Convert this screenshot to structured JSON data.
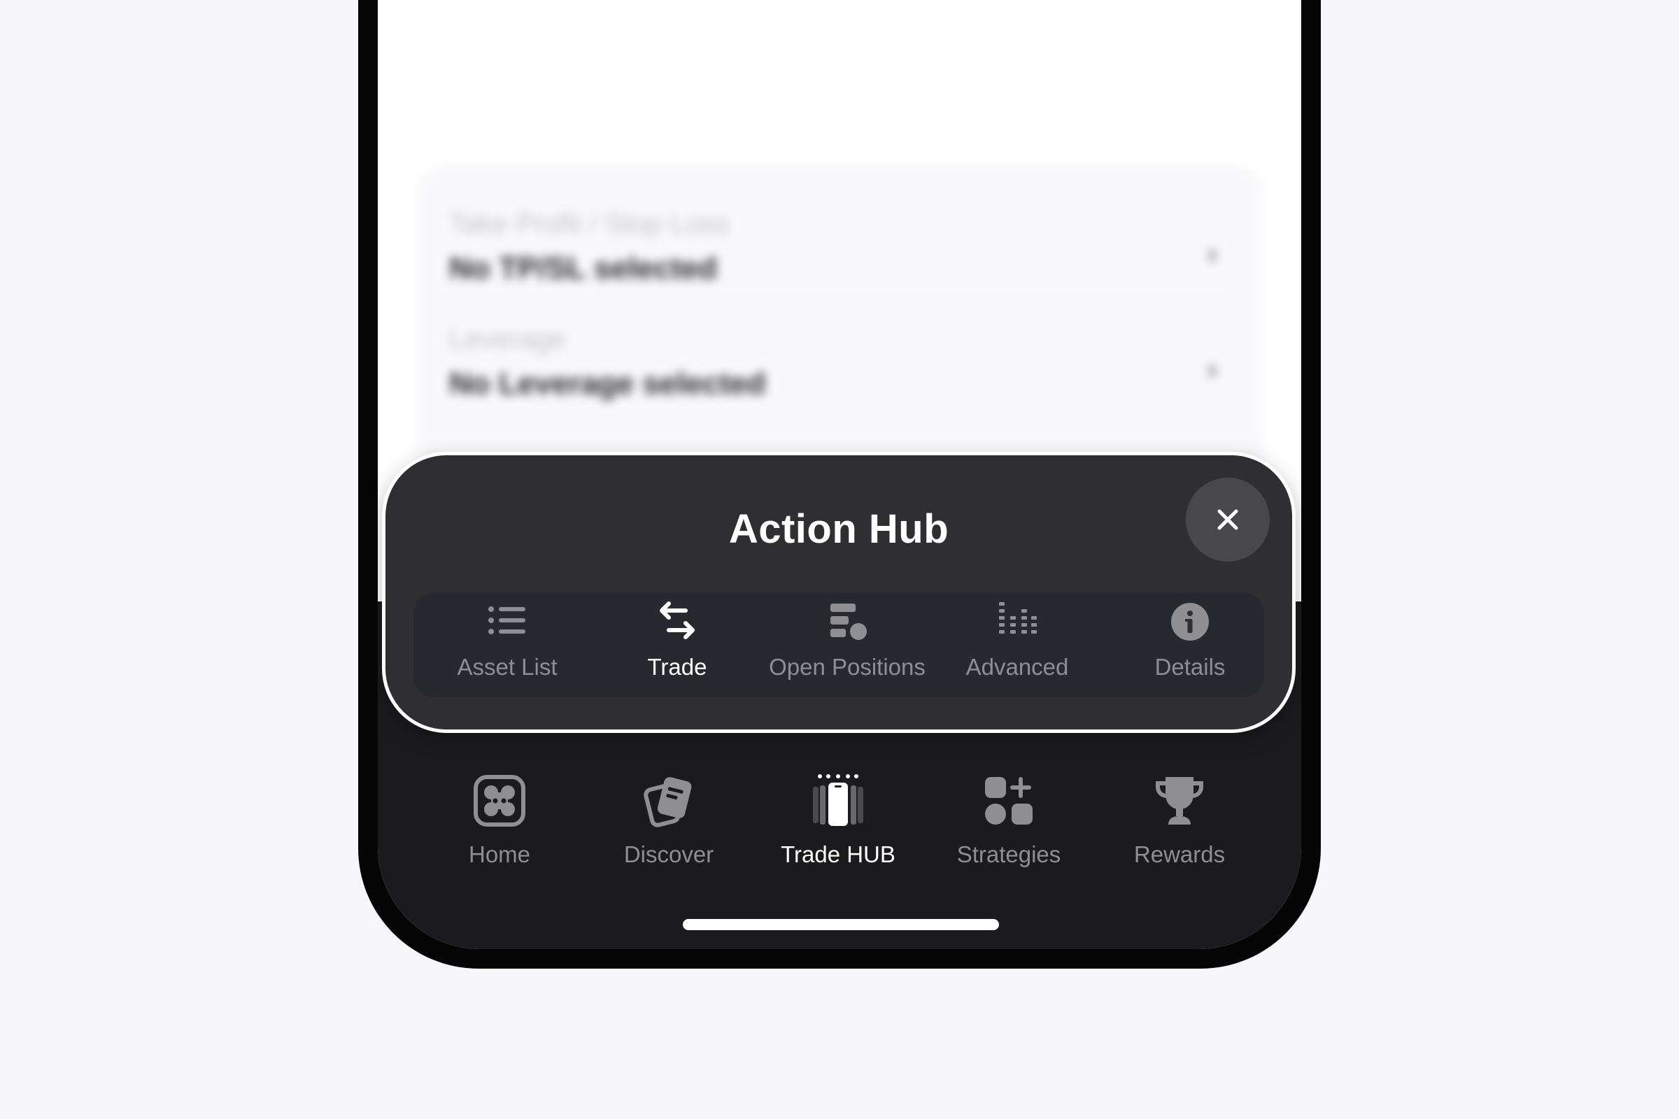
{
  "background_content": {
    "rows": [
      {
        "label": "Take Profit / Stop Loss",
        "value": "No TP/SL selected"
      },
      {
        "label": "Leverage",
        "value": "No Leverage selected"
      }
    ]
  },
  "action_hub": {
    "title": "Action Hub",
    "close_icon": "close-icon",
    "tabs": [
      {
        "label": "Asset List",
        "icon": "list-icon",
        "active": false
      },
      {
        "label": "Trade",
        "icon": "swap-arrows-icon",
        "active": true
      },
      {
        "label": "Open Positions",
        "icon": "positions-icon",
        "active": false
      },
      {
        "label": "Advanced",
        "icon": "order-book-icon",
        "active": false
      },
      {
        "label": "Details",
        "icon": "info-icon",
        "active": false
      }
    ]
  },
  "nav": {
    "items": [
      {
        "label": "Home",
        "icon": "home-icon",
        "active": false
      },
      {
        "label": "Discover",
        "icon": "discover-icon",
        "active": false
      },
      {
        "label": "Trade HUB",
        "icon": "trade-hub-icon",
        "active": true
      },
      {
        "label": "Strategies",
        "icon": "strategies-icon",
        "active": false
      },
      {
        "label": "Rewards",
        "icon": "trophy-icon",
        "active": false
      }
    ]
  },
  "colors": {
    "accent": "#ffffff",
    "inactive": "#8e8e93",
    "panel": "#2f2f32",
    "nav_bg": "#1b1b1d"
  }
}
